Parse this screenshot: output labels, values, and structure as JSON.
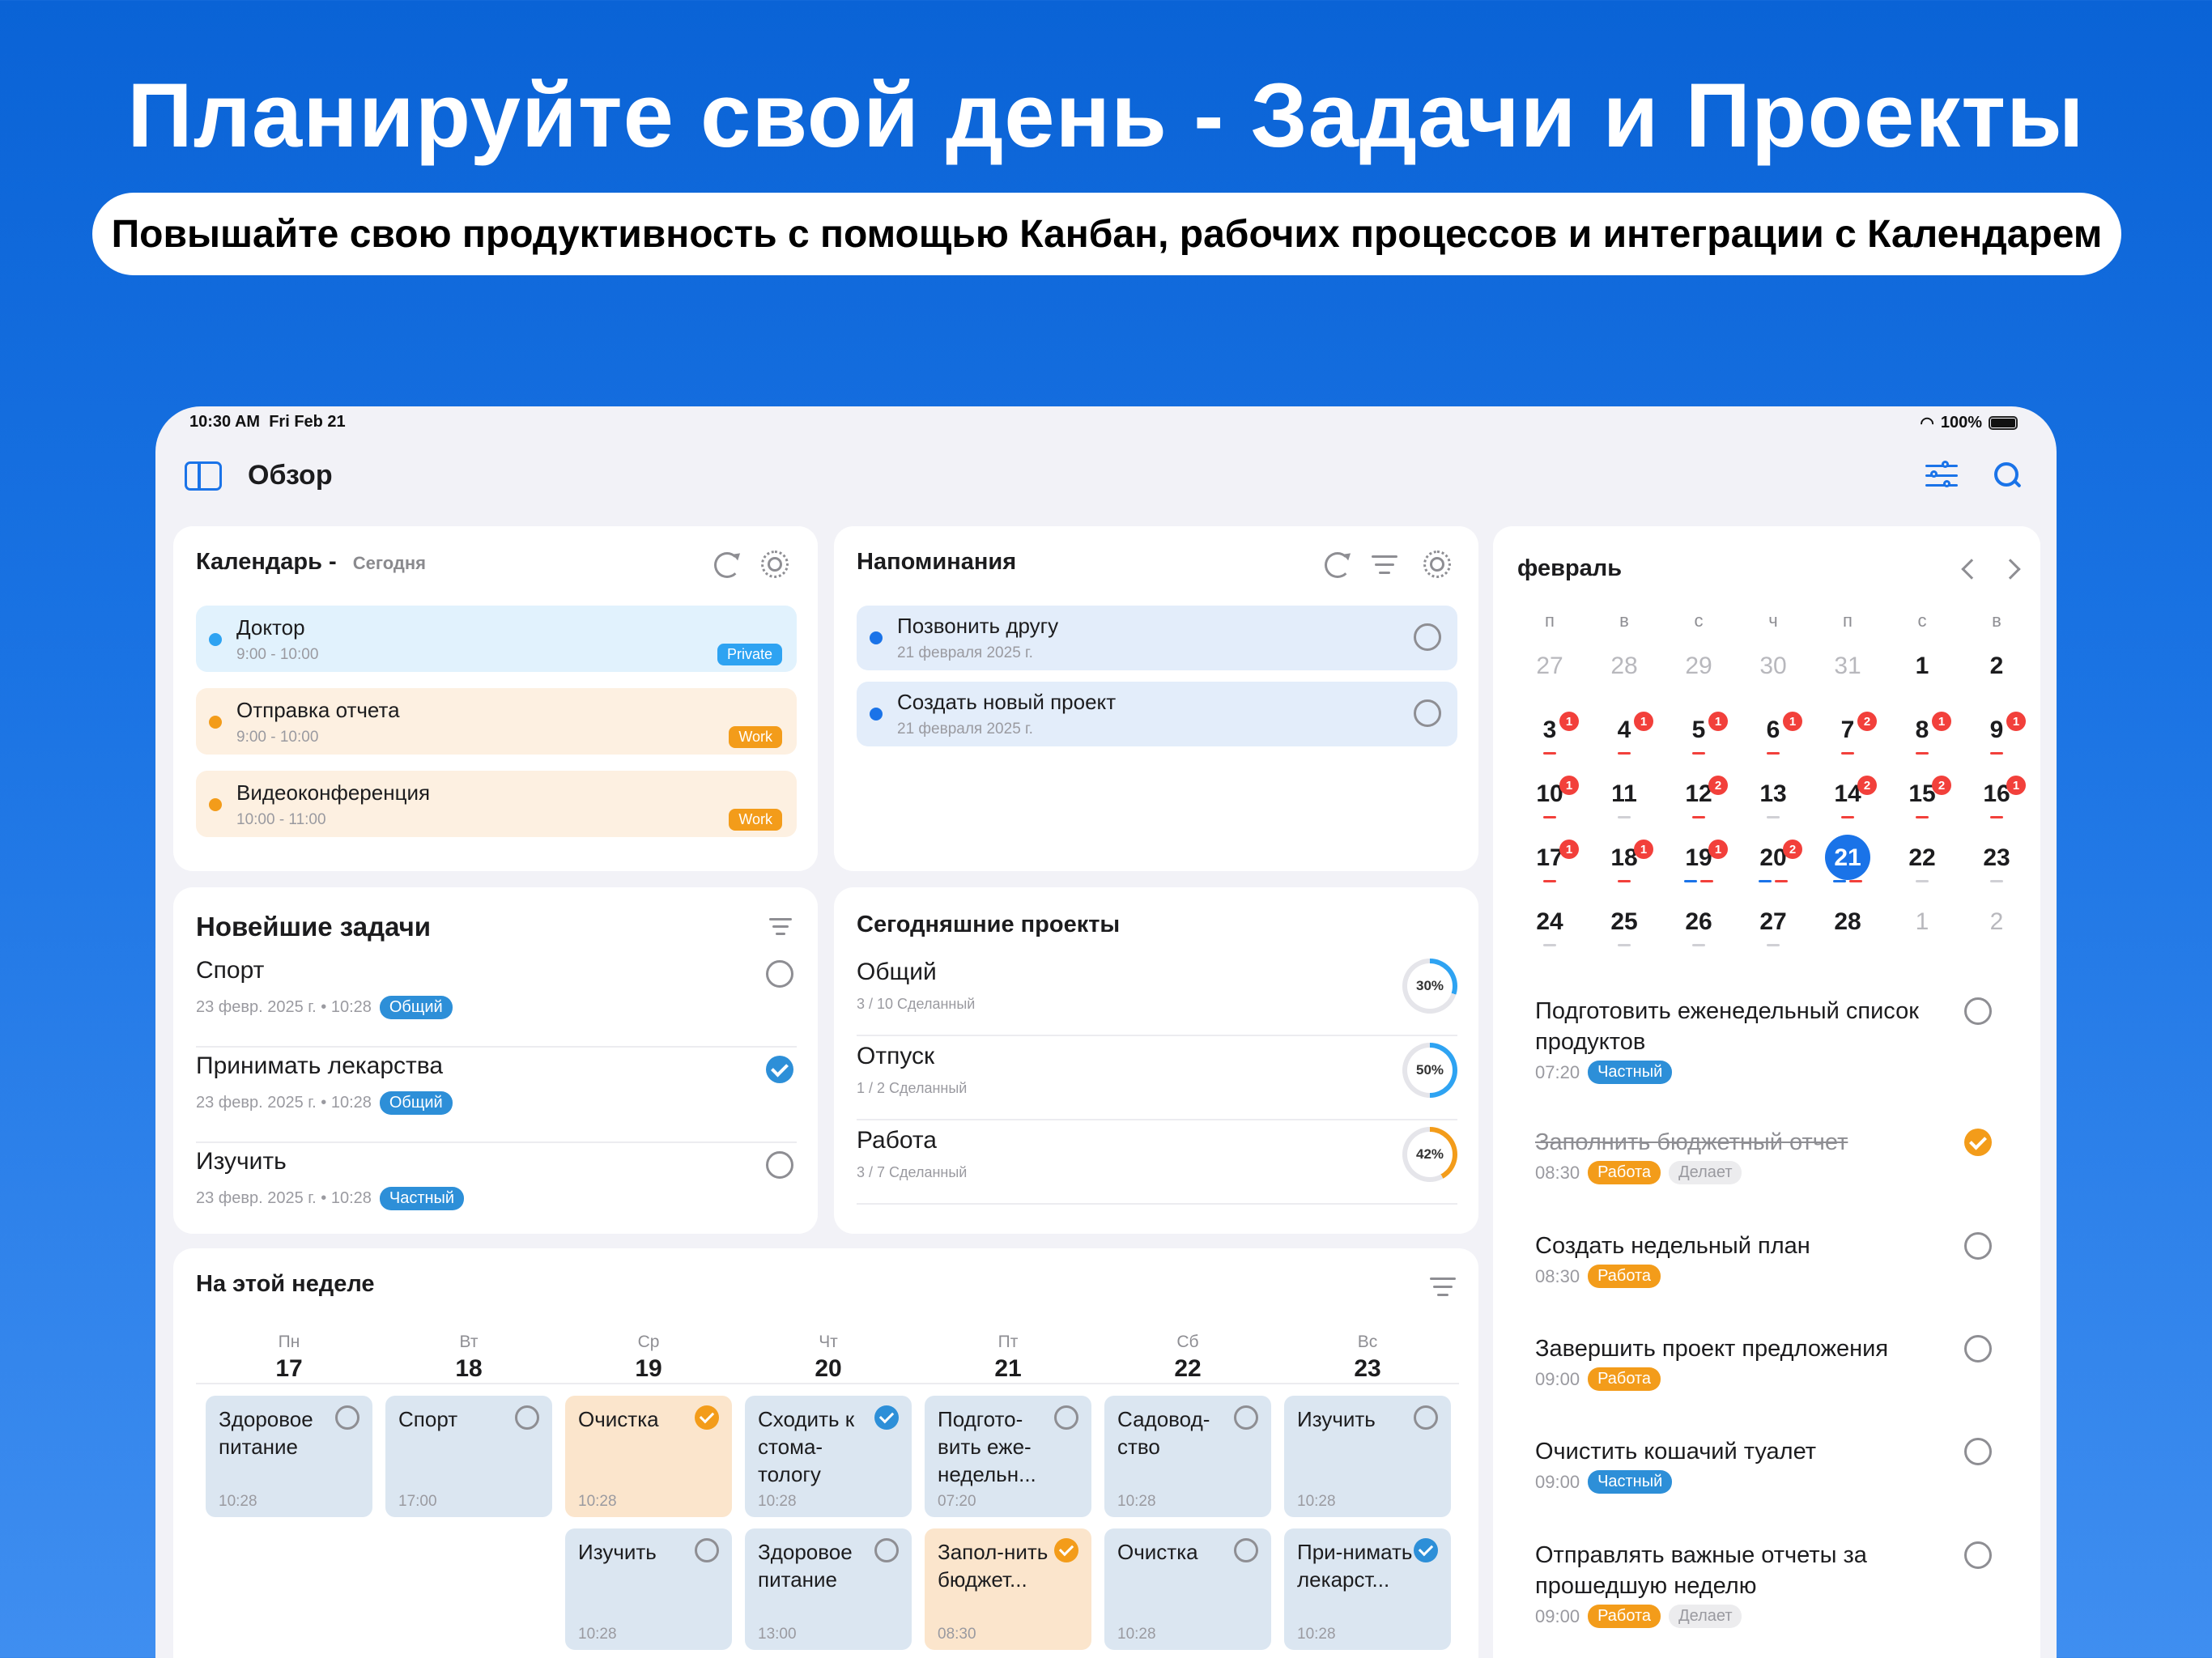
{
  "promo": {
    "headline": "Планируйте свой день - Задачи и Проекты",
    "subheadline": "Повышайте свою продуктивность с помощью Канбан, рабочих процессов и интеграции с Календарем"
  },
  "status_bar": {
    "time": "10:30 AM",
    "date": "Fri Feb 21",
    "battery": "100%"
  },
  "header": {
    "title": "Обзор"
  },
  "calendar_card": {
    "title": "Календарь",
    "separator": "-",
    "subtitle": "Сегодня",
    "events": [
      {
        "name": "Доктор",
        "time": "9:00 - 10:00",
        "tag": "Private",
        "color": "#2ea3f2"
      },
      {
        "name": "Отправка отчета",
        "time": "9:00 - 10:00",
        "tag": "Work",
        "color": "#f39c1a"
      },
      {
        "name": "Видеоконференция",
        "time": "10:00 - 11:00",
        "tag": "Work",
        "color": "#f39c1a"
      }
    ]
  },
  "reminders_card": {
    "title": "Напоминания",
    "items": [
      {
        "name": "Позвонить другу",
        "date": "21 февраля 2025 г."
      },
      {
        "name": "Создать новый проект",
        "date": "21 февраля 2025 г."
      }
    ]
  },
  "tasks_card": {
    "title": "Новейшие задачи",
    "items": [
      {
        "name": "Спорт",
        "meta": "23 февр. 2025 г. • 10:28",
        "tag": "Общий",
        "done": false
      },
      {
        "name": "Принимать лекарства",
        "meta": "23 февр. 2025 г. • 10:28",
        "tag": "Общий",
        "done": true
      },
      {
        "name": "Изучить",
        "meta": "23 февр. 2025 г. • 10:28",
        "tag": "Частный",
        "done": false
      }
    ]
  },
  "projects_card": {
    "title": "Сегодняшние проекты",
    "items": [
      {
        "name": "Общий",
        "meta": "3 / 10 Сделанный",
        "percent_label": "30%",
        "progress": 0.3,
        "color": "#2ea3f2"
      },
      {
        "name": "Отпуск",
        "meta": "1 / 2 Сделанный",
        "percent_label": "50%",
        "progress": 0.5,
        "color": "#2ea3f2"
      },
      {
        "name": "Работа",
        "meta": "3 / 7 Сделанный",
        "percent_label": "42%",
        "progress": 0.42,
        "color": "#f39c1a"
      }
    ]
  },
  "week_card": {
    "title": "На этой неделе",
    "days": [
      {
        "dow": "Пн",
        "num": "17"
      },
      {
        "dow": "Вт",
        "num": "18"
      },
      {
        "dow": "Ср",
        "num": "19"
      },
      {
        "dow": "Чт",
        "num": "20"
      },
      {
        "dow": "Пт",
        "num": "21"
      },
      {
        "dow": "Сб",
        "num": "22"
      },
      {
        "dow": "Вс",
        "num": "23"
      }
    ],
    "tiles": [
      {
        "name": "Здоровое питание",
        "time": "10:28"
      },
      {
        "name": "Спорт",
        "time": "17:00"
      },
      {
        "name": "Очистка",
        "time": "10:28"
      },
      {
        "name": "Сходить к стома-тологу",
        "time": "10:28"
      },
      {
        "name": "Подгото-вить еже-недельн...",
        "time": "07:20"
      },
      {
        "name": "Садовод-ство",
        "time": "10:28"
      },
      {
        "name": "Изучить",
        "time": "10:28"
      },
      {
        "name": "Изучить",
        "time": "10:28"
      },
      {
        "name": "Здоровое питание",
        "time": "13:00"
      },
      {
        "name": "Запол-нить бюджет...",
        "time": "08:30"
      },
      {
        "name": "Очистка",
        "time": "10:28"
      },
      {
        "name": "При-нимать лекарст...",
        "time": "10:28"
      }
    ]
  },
  "month_card": {
    "month": "февраль",
    "weekdays": [
      "п",
      "в",
      "с",
      "ч",
      "п",
      "с",
      "в"
    ],
    "days": [
      "27",
      "28",
      "29",
      "30",
      "31",
      "1",
      "2",
      "3",
      "4",
      "5",
      "6",
      "7",
      "8",
      "9",
      "10",
      "11",
      "12",
      "13",
      "14",
      "15",
      "16",
      "17",
      "18",
      "19",
      "20",
      "21",
      "22",
      "23",
      "24",
      "25",
      "26",
      "27",
      "28",
      "1",
      "2"
    ],
    "badges": [
      "1",
      "1",
      "1",
      "1",
      "2",
      "1",
      "1",
      "1",
      "2",
      "2",
      "2",
      "1",
      "1",
      "1",
      "1",
      "2"
    ],
    "agenda": [
      {
        "name": "Подготовить еженедельный список продуктов",
        "time": "07:20",
        "tag": "Частный",
        "done": false
      },
      {
        "name": "Заполнить бюджетный отчет",
        "time": "08:30",
        "tag": "Работа",
        "extra": "Делает",
        "done": true
      },
      {
        "name": "Создать недельный план",
        "time": "08:30",
        "tag": "Работа",
        "done": false
      },
      {
        "name": "Завершить проект предложения",
        "time": "09:00",
        "tag": "Работа",
        "done": false
      },
      {
        "name": "Очистить кошачий туалет",
        "time": "09:00",
        "tag": "Частный",
        "done": false
      },
      {
        "name": "Отправлять важные отчеты за прошедшую неделю",
        "time": "09:00",
        "tag": "Работа",
        "extra": "Делает",
        "done": false
      }
    ]
  },
  "colors": {
    "accent": "#1a73e8",
    "orange": "#f39c1a",
    "badge_red": "#f2403b"
  }
}
